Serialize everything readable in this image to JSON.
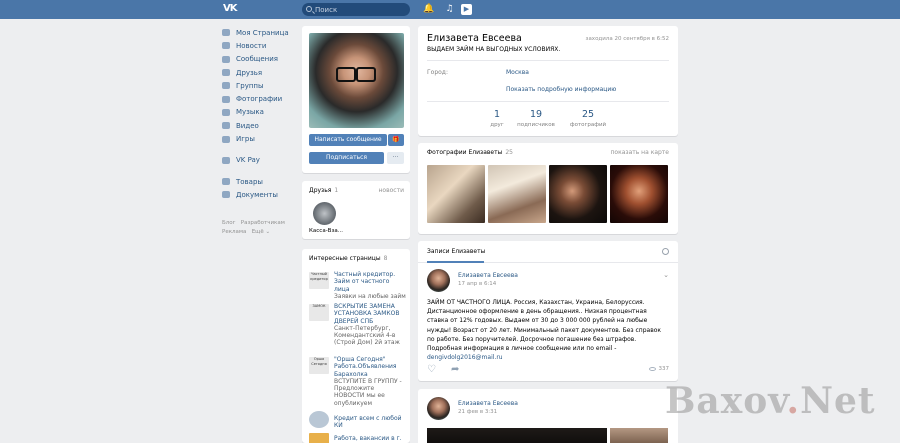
{
  "header": {
    "logo": "VK",
    "search_placeholder": "Поиск"
  },
  "menu": {
    "items": [
      "Моя Страница",
      "Новости",
      "Сообщения",
      "Друзья",
      "Группы",
      "Фотографии",
      "Музыка",
      "Видео",
      "Игры"
    ],
    "items2": [
      "VK Pay"
    ],
    "items3": [
      "Товары",
      "Документы"
    ],
    "footer": [
      "Блог",
      "Разработчикам",
      "Реклама",
      "Ещё ⌄"
    ]
  },
  "profile": {
    "actions": {
      "message": "Написать сообщение",
      "subscribe": "Подписаться",
      "gift": "🎁",
      "more": "···"
    },
    "friends": {
      "title": "Друзья",
      "count": "1",
      "link": "новости",
      "items": [
        "Касса-Вза..."
      ]
    },
    "pages": {
      "title": "Интересные страницы",
      "count": "8",
      "items": [
        {
          "title": "Частный кредитор. Займ от частного лица",
          "desc": "Заявки на любые займ",
          "thumb": "Частный кредитор"
        },
        {
          "title": "ВСКРЫТИЕ ЗАМЕНА УСТАНОВКА ЗАМКОВ ДВЕРЕЙ СПБ",
          "desc": "Санкт-Петербург, Комендантский 4-в (Строй Дом) 2й этаж",
          "thumb": "ЗАМОК"
        },
        {
          "title": "\"Орша Сегодня\" Работа.Объявления Барахолка",
          "desc": "ВСТУПИТЕ В ГРУППУ - Предложите НОВОСТИ мы ее опубликуем",
          "thumb": "Орша Сегодня"
        },
        {
          "title": "Кредит всем с любой КИ",
          "desc": "",
          "thumb": ""
        },
        {
          "title": "Работа, вакансии в г.",
          "desc": "",
          "thumb": ""
        }
      ]
    }
  },
  "info": {
    "name": "Елизавета Евсеева",
    "status": "ВЫДАЕМ ЗАЙМ НА ВЫГОДНЫХ УСЛОВИЯХ.",
    "online": "заходила 20 сентября в 6:52",
    "city_label": "Город:",
    "city_value": "Москва",
    "more": "Показать подробную информацию",
    "counters": [
      {
        "value": "1",
        "label": "друг"
      },
      {
        "value": "19",
        "label": "подписчиков"
      },
      {
        "value": "25",
        "label": "фотографий"
      }
    ]
  },
  "photos": {
    "title": "Фотографии Елизаветы",
    "count": "25",
    "link": "показать на карте"
  },
  "wall": {
    "tab": "Записи Елизаветы",
    "post1": {
      "author": "Елизавета Евсеева",
      "date": "17 апр в 6:14",
      "text": "ЗАЙМ ОТ ЧАСТНОГО ЛИЦА. Россия, Казахстан, Украина, Белоруссия. Дистанционное оформление в день обращения.. Низкая процентная ставка от 12% годовых. Выдаем от 30 до 3 000 000 рублей на любые нужды! Возраст от 20 лет. Минимальный пакет документов. Без справок по работе. Без поручителей. Досрочное погашение без штрафов. Подробная информация в личное сообщение или по email -",
      "email": "dengivdolg2016@mail.ru",
      "views": "337"
    },
    "post2": {
      "author": "Елизавета Евсеева",
      "date": "21 фев в 3:31"
    }
  },
  "watermark": {
    "part1": "Baxov",
    "dot": ".",
    "part2": "Net"
  },
  "colors": {
    "header": "#4a76a8",
    "link": "#2a5885",
    "button": "#5181b8",
    "background": "#edeef0"
  }
}
